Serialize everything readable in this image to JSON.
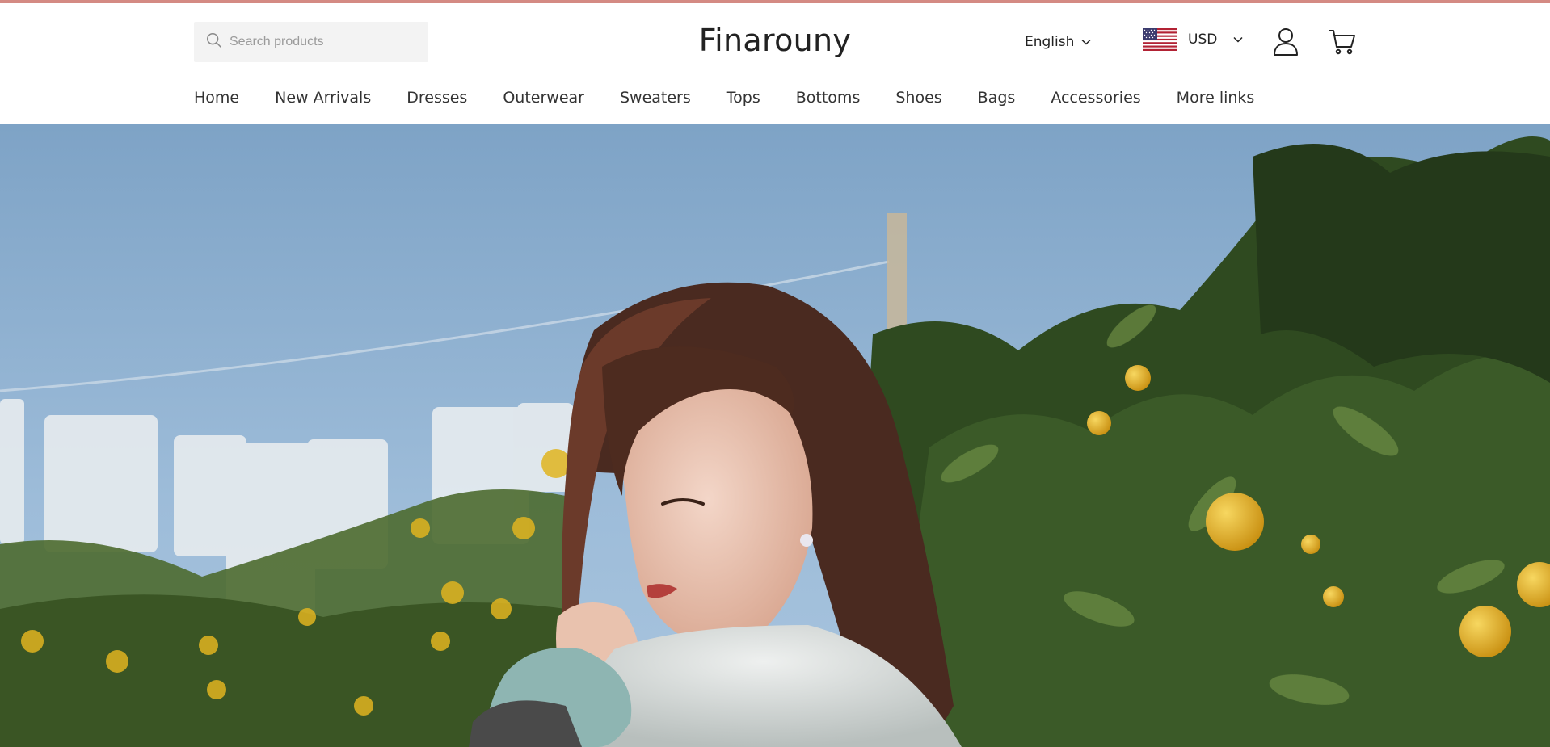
{
  "header": {
    "accent_color": "#d48a83",
    "search": {
      "placeholder": "Search products",
      "icon": "search-icon"
    },
    "logo": "Finarouny",
    "language": {
      "selected": "English"
    },
    "currency": {
      "selected": "USD",
      "flag": "us-flag-icon"
    },
    "account_icon": "user-icon",
    "cart_icon": "cart-icon"
  },
  "nav": {
    "items": [
      {
        "label": "Home"
      },
      {
        "label": "New Arrivals"
      },
      {
        "label": "Dresses"
      },
      {
        "label": "Outerwear"
      },
      {
        "label": "Sweaters"
      },
      {
        "label": "Tops"
      },
      {
        "label": "Bottoms"
      },
      {
        "label": "Shoes"
      },
      {
        "label": "Bags"
      },
      {
        "label": "Accessories"
      },
      {
        "label": "More links"
      }
    ]
  },
  "hero": {
    "sky_color": "#8fb2d3",
    "foliage_color": "#2d4a22",
    "fruit_color": "#e3b320"
  }
}
